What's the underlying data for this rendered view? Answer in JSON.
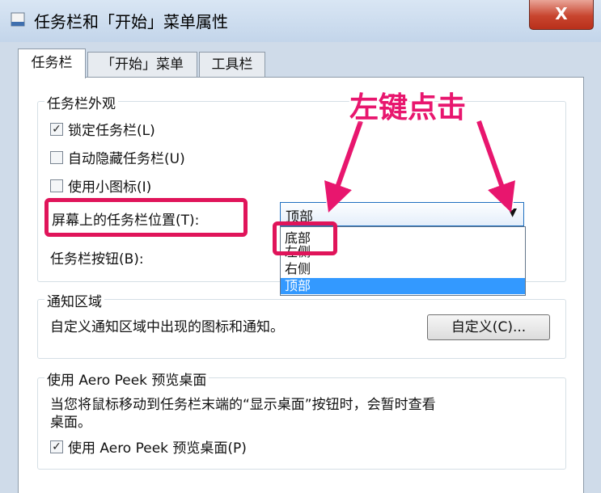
{
  "window": {
    "title": "任务栏和「开始」菜单属性",
    "close_label": "X"
  },
  "tabs": [
    {
      "label": "任务栏",
      "active": true
    },
    {
      "label": "「开始」菜单",
      "active": false
    },
    {
      "label": "工具栏",
      "active": false
    }
  ],
  "appearance": {
    "legend": "任务栏外观",
    "checkboxes": [
      {
        "label": "锁定任务栏(L)",
        "checked": true
      },
      {
        "label": "自动隐藏任务栏(U)",
        "checked": false
      },
      {
        "label": "使用小图标(I)",
        "checked": false
      }
    ],
    "position_label": "屏幕上的任务栏位置(T):",
    "position_value": "顶部",
    "position_options": [
      "底部",
      "左侧",
      "右侧",
      "顶部"
    ],
    "buttons_label": "任务栏按钮(B):"
  },
  "notify": {
    "legend": "通知区域",
    "description": "自定义通知区域中出现的图标和通知。",
    "customize_label": "自定义(C)..."
  },
  "peek": {
    "legend": "使用 Aero Peek 预览桌面",
    "description_line1": "当您将鼠标移动到任务栏末端的“显示桌面”按钮时，会暂时查看",
    "description_line2": "桌面。",
    "checkbox_label": "使用 Aero Peek 预览桌面(P)",
    "checked": true
  },
  "annotation": {
    "text": "左键点击",
    "color": "#e8166e"
  },
  "icons": {
    "check": "✓",
    "dropdown_arrow": "▼"
  }
}
